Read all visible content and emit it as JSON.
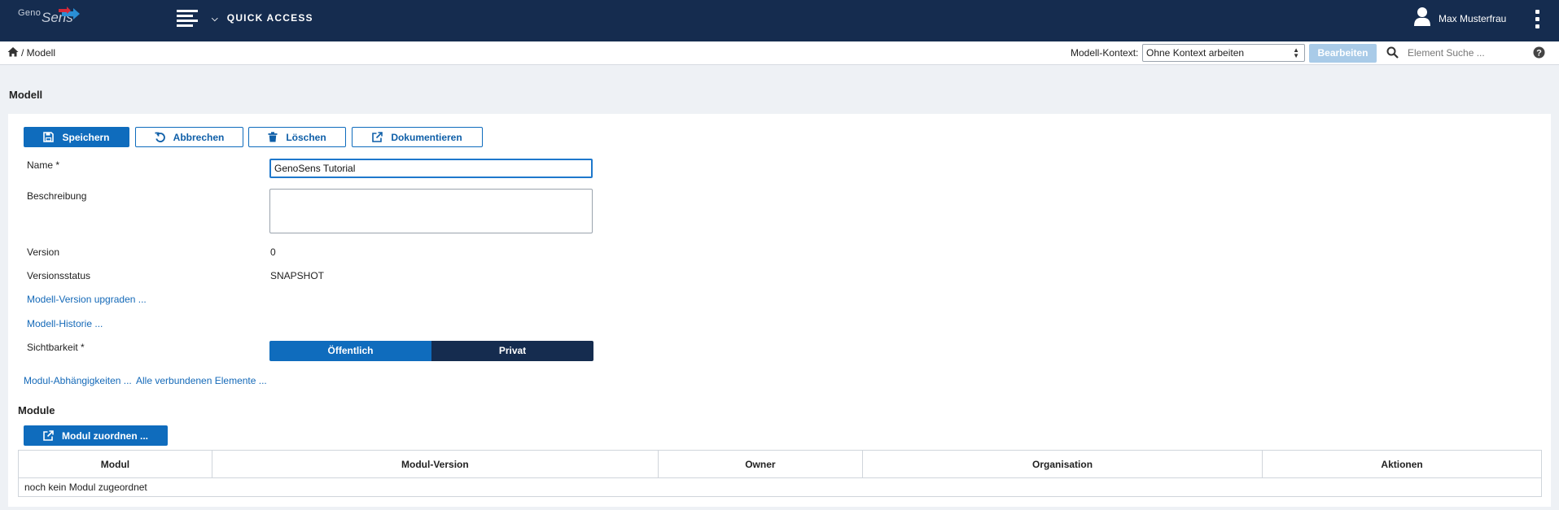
{
  "brand": {
    "logo_word1": "Geno",
    "logo_word2": "Sens"
  },
  "topbar": {
    "quick_access": "QUICK ACCESS",
    "user_name": "Max Musterfrau"
  },
  "breadcrumb": {
    "text": "/ Modell"
  },
  "context": {
    "label": "Modell-Kontext:",
    "selected": "Ohne Kontext arbeiten",
    "edit_button": "Bearbeiten"
  },
  "search": {
    "placeholder": "Element Suche ..."
  },
  "page": {
    "title": "Modell"
  },
  "toolbar": {
    "save": "Speichern",
    "cancel": "Abbrechen",
    "delete": "Löschen",
    "document": "Dokumentieren"
  },
  "form": {
    "name_label": "Name *",
    "name_value": "GenoSens Tutorial",
    "description_label": "Beschreibung",
    "description_value": "",
    "version_label": "Version",
    "version_value": "0",
    "status_label": "Versionsstatus",
    "status_value": "SNAPSHOT",
    "upgrade_link": "Modell-Version upgraden ...",
    "history_link": "Modell-Historie ...",
    "visibility_label": "Sichtbarkeit *",
    "visibility_options": [
      "Öffentlich",
      "Privat"
    ],
    "visibility_selected": "Öffentlich",
    "dependencies_link": "Modul-Abhängigkeiten ...",
    "connected_link": "Alle verbundenen Elemente ..."
  },
  "modules": {
    "title": "Module",
    "assign_button": "Modul zuordnen ...",
    "columns": [
      "Modul",
      "Modul-Version",
      "Owner",
      "Organisation",
      "Aktionen"
    ],
    "empty_text": "noch kein Modul zugeordnet"
  },
  "colors": {
    "navbar": "#152c4f",
    "primary": "#0f6cbd",
    "disabled_button": "#a9cbe8",
    "link": "#1469b8"
  }
}
